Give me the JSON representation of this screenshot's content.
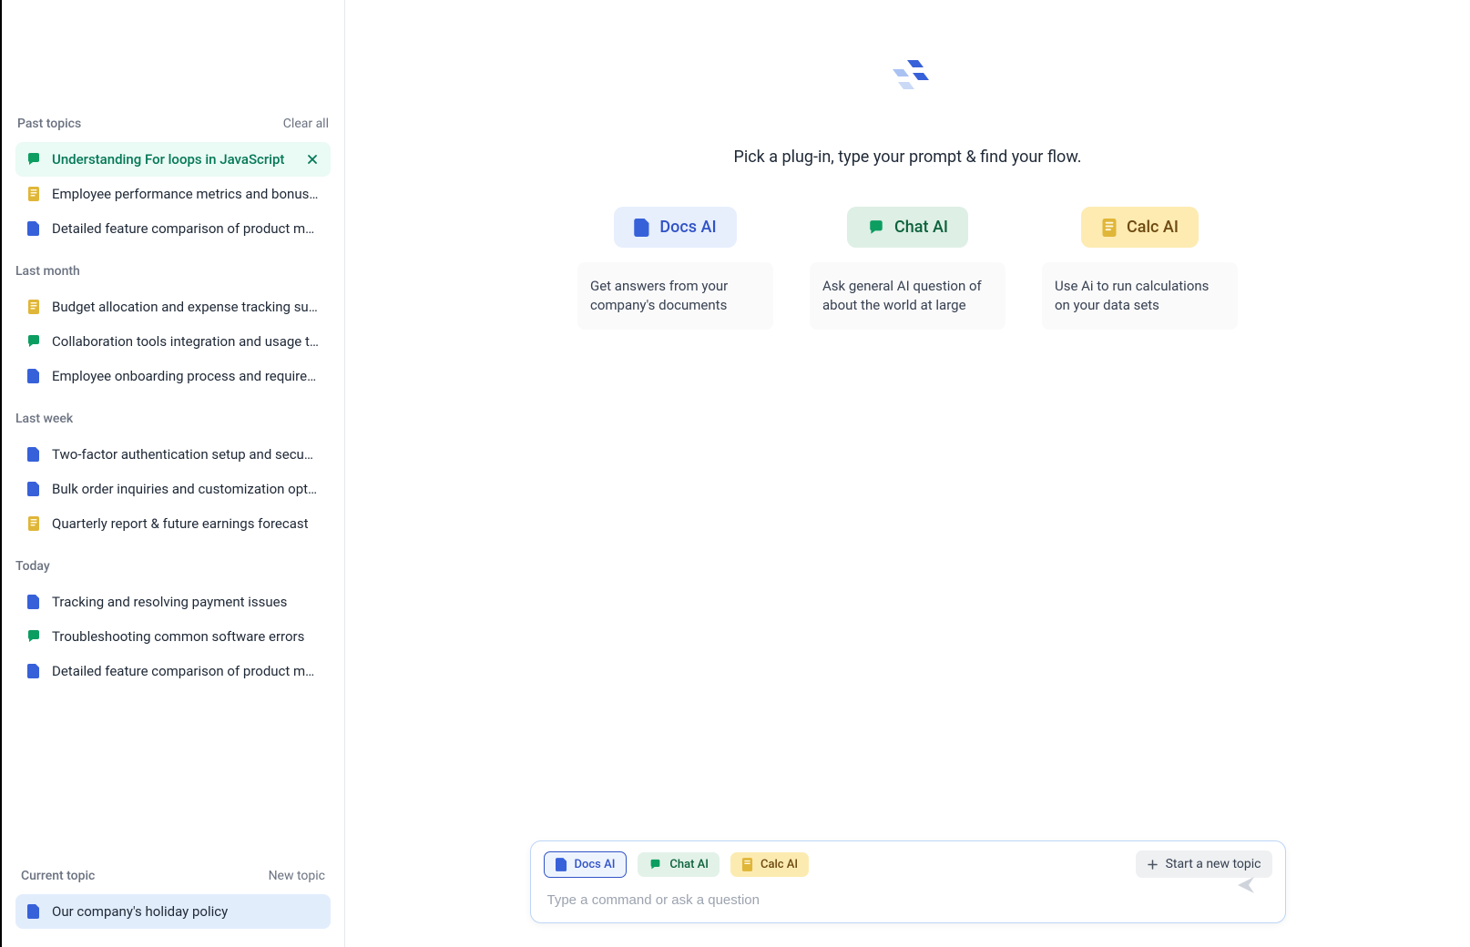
{
  "sidebar": {
    "past_label": "Past topics",
    "clear_label": "Clear all",
    "groups": {
      "past": [
        {
          "icon": "chat",
          "label": "Understanding For loops in JavaScript",
          "active": true
        },
        {
          "icon": "doc-yellow",
          "label": "Employee performance metrics and bonus…"
        },
        {
          "icon": "doc-blue",
          "label": "Detailed feature comparison of product m…"
        }
      ],
      "last_month_label": "Last month",
      "last_month": [
        {
          "icon": "doc-yellow",
          "label": "Budget allocation and expense tracking su…"
        },
        {
          "icon": "chat",
          "label": "Collaboration tools integration and usage ti…"
        },
        {
          "icon": "doc-blue",
          "label": "Employee onboarding process and require…"
        }
      ],
      "last_week_label": "Last week",
      "last_week": [
        {
          "icon": "doc-blue",
          "label": "Two-factor authentication setup and secu…"
        },
        {
          "icon": "doc-blue",
          "label": "Bulk order inquiries and customization opt…"
        },
        {
          "icon": "doc-yellow",
          "label": "Quarterly report & future earnings forecast"
        }
      ],
      "today_label": "Today",
      "today": [
        {
          "icon": "doc-blue",
          "label": "Tracking and resolving payment issues"
        },
        {
          "icon": "chat",
          "label": "Troubleshooting common software errors"
        },
        {
          "icon": "doc-blue",
          "label": "Detailed feature comparison of product m…"
        }
      ]
    },
    "current_label": "Current topic",
    "new_topic_label": "New topic",
    "current_item": {
      "icon": "doc-blue",
      "label": "Our company's holiday policy"
    }
  },
  "main": {
    "tagline": "Pick a plug-in, type your prompt & find your flow.",
    "plugins": {
      "docs": {
        "label": "Docs AI",
        "desc": "Get answers from your company's documents"
      },
      "chat": {
        "label": "Chat AI",
        "desc": "Ask general AI question of about the world at large"
      },
      "calc": {
        "label": "Calc AI",
        "desc": "Use Ai to run calculations on your data sets"
      }
    }
  },
  "input": {
    "docs_label": "Docs AI",
    "chat_label": "Chat AI",
    "calc_label": "Calc AI",
    "new_topic_label": "Start a new topic",
    "placeholder": "Type a command or ask a question"
  }
}
